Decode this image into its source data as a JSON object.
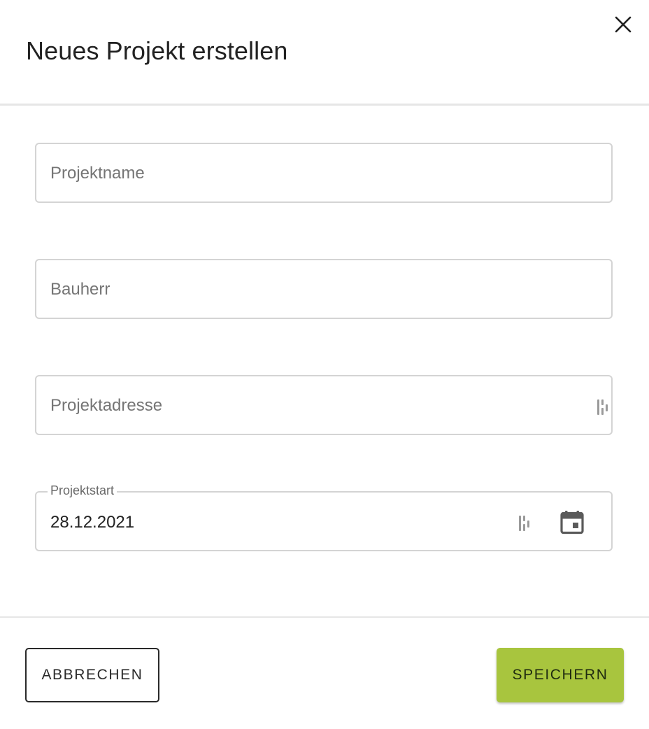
{
  "dialog": {
    "title": "Neues Projekt erstellen"
  },
  "fields": {
    "project_name": {
      "placeholder": "Projektname",
      "value": ""
    },
    "client": {
      "placeholder": "Bauherr",
      "value": ""
    },
    "address": {
      "placeholder": "Projektadresse",
      "value": ""
    },
    "start": {
      "label": "Projektstart",
      "value": "28.12.2021"
    }
  },
  "actions": {
    "cancel_label": "ABBRECHEN",
    "save_label": "SPEICHERN"
  },
  "colors": {
    "accent": "#a8c53e",
    "border": "#d4d4d4",
    "text": "#222222",
    "placeholder": "#707070"
  },
  "icons": {
    "close": "close-icon",
    "password_manager": "password-manager-icon",
    "calendar": "calendar-icon"
  }
}
